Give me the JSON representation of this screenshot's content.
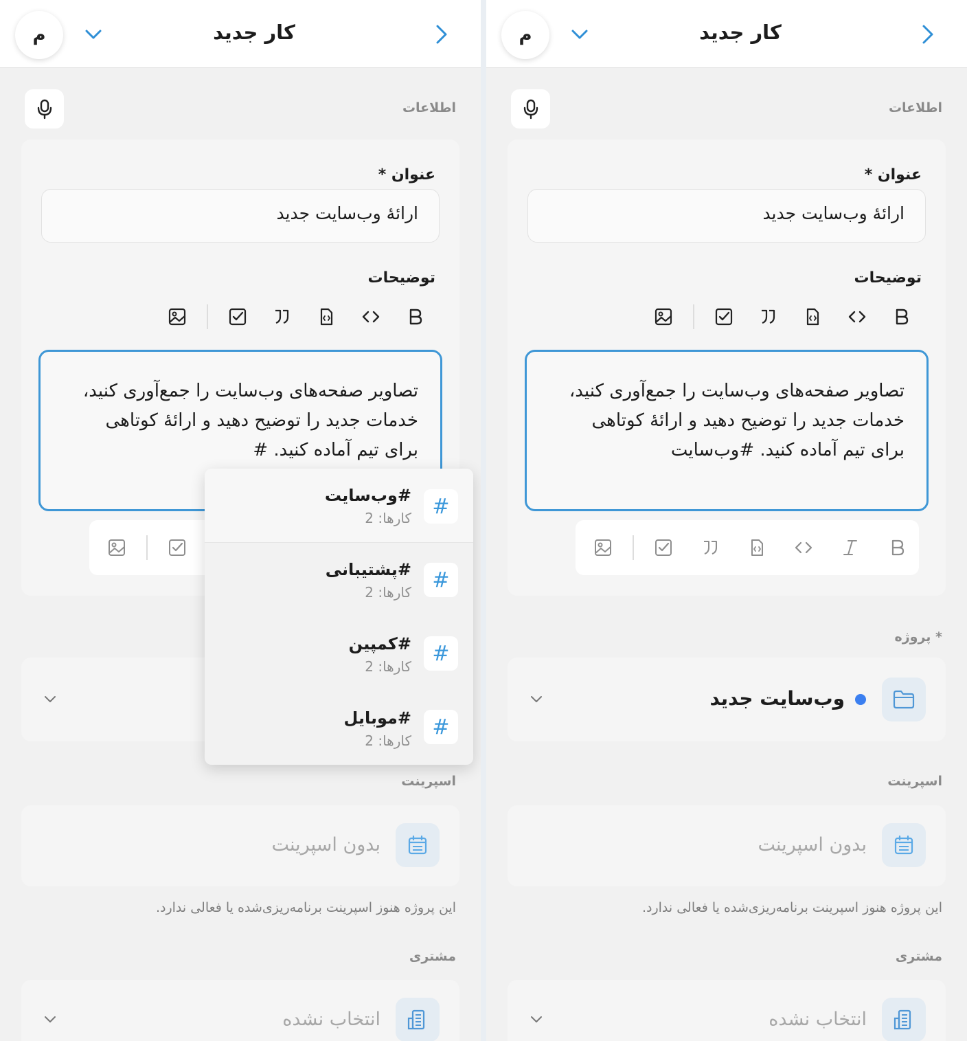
{
  "header": {
    "title": "کار جدید",
    "avatar_initial": "م"
  },
  "info": {
    "section_label": "اطلاعات"
  },
  "title_field": {
    "label": "عنوان *",
    "value": "ارائهٔ وب‌سایت جدید"
  },
  "description_field": {
    "label": "توضیحات",
    "lines_left": [
      "تصاویر صفحه‌های وب‌سایت را جمع‌آوری کنید،",
      "خدمات جدید را توضیح دهید و ارائهٔ کوتاهی",
      "برای تیم آماده کنید. #"
    ],
    "lines_right": [
      "تصاویر صفحه‌های وب‌سایت را جمع‌آوری کنید،",
      "خدمات جدید را توضیح دهید و ارائهٔ کوتاهی",
      "برای تیم آماده کنید. #وب‌سایت"
    ]
  },
  "toolbar_icons": [
    "bold-icon",
    "italic-icon",
    "code-icon",
    "code-file-icon",
    "quote-icon",
    "checkbox-icon",
    "image-icon"
  ],
  "tag_suggestions": [
    {
      "name": "#وب‌سایت",
      "count": "کارها: 2"
    },
    {
      "name": "#پشتیبانی",
      "count": "کارها: 2"
    },
    {
      "name": "#کمپین",
      "count": "کارها: 2"
    },
    {
      "name": "#موبایل",
      "count": "کارها: 2"
    }
  ],
  "project": {
    "label": "پروژه *",
    "value": "وب‌سایت جدید",
    "dot_color": "#3b7ff0"
  },
  "sprint": {
    "label": "اسپرینت",
    "value": "بدون اسپرینت",
    "helper": "این پروژه هنوز اسپرینت برنامه‌ریزی‌شده یا فعالی ندارد."
  },
  "customer": {
    "label": "مشتری",
    "value": "انتخاب نشده"
  },
  "colors": {
    "accent": "#3f97d6",
    "panel_bg": "#f1f1f1",
    "card_bg": "#f5f5f5"
  }
}
